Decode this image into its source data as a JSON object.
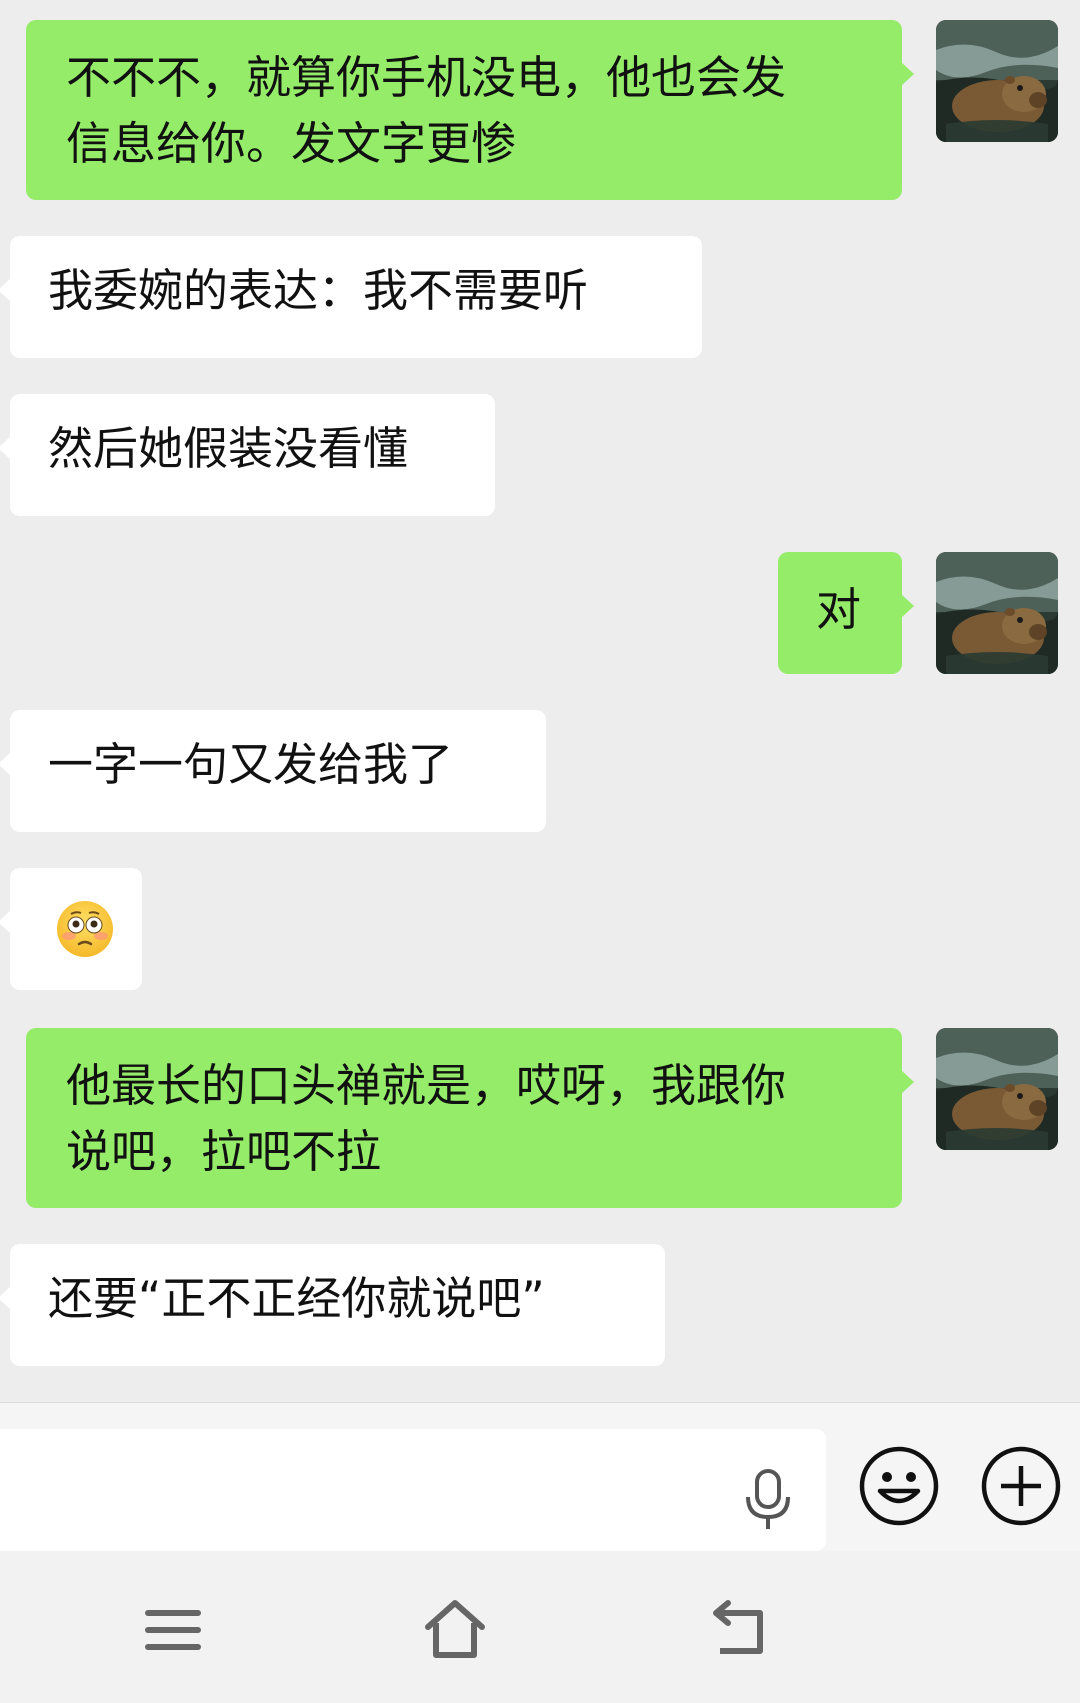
{
  "messages": [
    {
      "side": "me",
      "lines": [
        "不不不，就算你手机没电，他也会发",
        "信息给你。发文字更惨"
      ]
    },
    {
      "side": "them",
      "text": "我委婉的表达：我不需要听"
    },
    {
      "side": "them",
      "text": "然后她假装没看懂"
    },
    {
      "side": "me",
      "text": "对"
    },
    {
      "side": "them",
      "text": "一字一句又发给我了"
    },
    {
      "side": "them",
      "emoji": "flushed-face"
    },
    {
      "side": "me",
      "lines": [
        "他最长的口头禅就是，哎呀，我跟你",
        "说吧，拉吧不拉"
      ]
    },
    {
      "side": "them",
      "text": "还要“正不正经你就说吧”"
    }
  ],
  "input": {
    "value": ""
  },
  "icons": {
    "avatar": "capybara-avatar",
    "mic": "microphone-icon",
    "emoji": "smiley-icon",
    "plus": "plus-icon",
    "nav_menu": "menu-icon",
    "nav_home": "home-icon",
    "nav_back": "back-icon"
  },
  "colors": {
    "my_bubble": "#95ec69",
    "their_bubble": "#ffffff",
    "background": "#ededed"
  }
}
